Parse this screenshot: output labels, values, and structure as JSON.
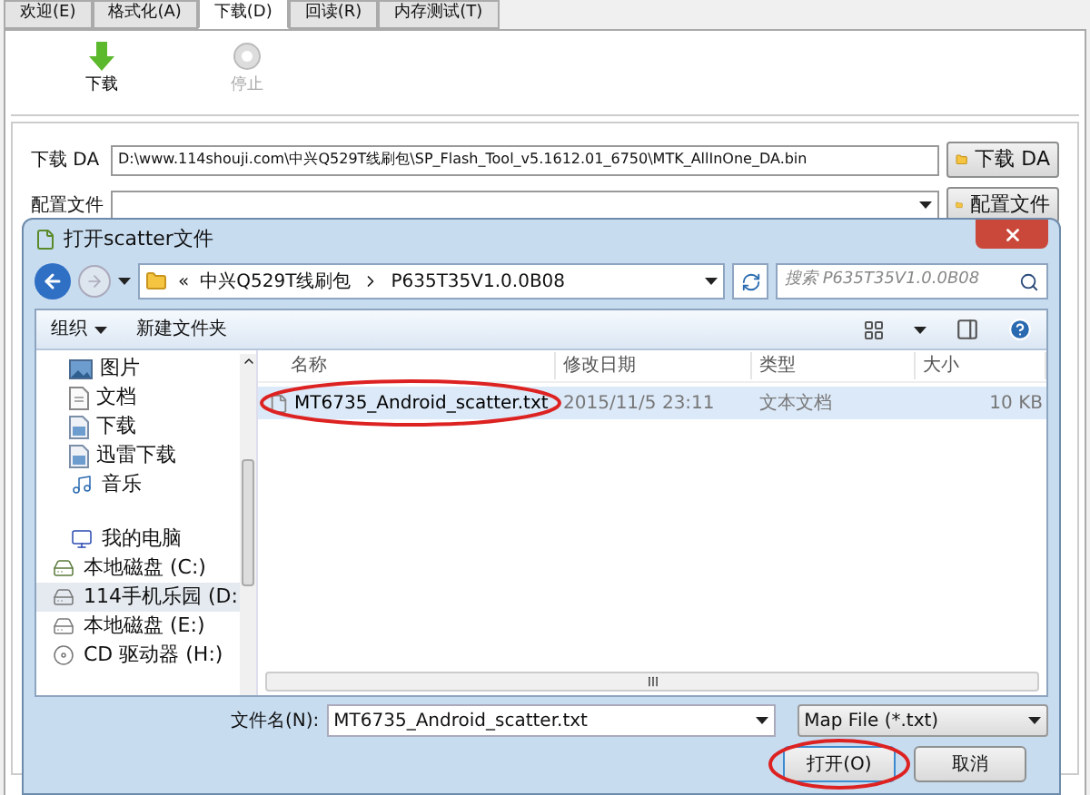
{
  "tabs": [
    {
      "label": "欢迎(E)",
      "selected": false
    },
    {
      "label": "格式化(A)",
      "selected": false
    },
    {
      "label": "下载(D)",
      "selected": true
    },
    {
      "label": "回读(R)",
      "selected": false
    },
    {
      "label": "内存测试(T)",
      "selected": false
    }
  ],
  "toolbar": [
    {
      "kind": "download",
      "label": "下载",
      "disabled": false
    },
    {
      "kind": "stop",
      "label": "停止",
      "disabled": true
    }
  ],
  "da_row": {
    "label": "下载 DA",
    "value": "D:\\www.114shouji.com\\中兴Q529T线刷包\\SP_Flash_Tool_v5.1612.01_6750\\MTK_AllInOne_DA.bin",
    "button": "下载 DA"
  },
  "config_row": {
    "label": "配置文件",
    "button": "配置文件"
  },
  "dialog": {
    "title": "打开scatter文件",
    "overflow": "«",
    "breadcrumb": [
      "中兴Q529T线刷包",
      "P635T35V1.0.0B08"
    ],
    "search": {
      "placeholder": "搜索 P635T35V1.0.0B08"
    },
    "commands": [
      {
        "label": "组织",
        "has_menu": true
      },
      {
        "label": "新建文件夹",
        "has_menu": false
      }
    ],
    "sidebar": [
      {
        "kind": "pictures",
        "label": "图片",
        "selected": false
      },
      {
        "kind": "documents",
        "label": "文档",
        "selected": false
      },
      {
        "kind": "downloads",
        "label": "下载",
        "selected": false
      },
      {
        "kind": "downloads",
        "label": "迅雷下载",
        "selected": false
      },
      {
        "kind": "music",
        "label": "音乐",
        "selected": false
      },
      {
        "kind": "computer",
        "label": "我的电脑",
        "selected": false,
        "children": [
          {
            "kind": "system-drive",
            "label": "本地磁盘 (C:)",
            "selected": false
          },
          {
            "kind": "drive",
            "label": "114手机乐园 (D:",
            "selected": true
          },
          {
            "kind": "drive",
            "label": "本地磁盘 (E:)",
            "selected": false
          },
          {
            "kind": "cd",
            "label": "CD 驱动器 (H:)",
            "selected": false
          }
        ]
      }
    ],
    "columns": [
      "名称",
      "修改日期",
      "类型",
      "大小"
    ],
    "rows": [
      {
        "name": "MT6735_Android_scatter.txt",
        "date": "2015/11/5 23:11",
        "type": "文本文档",
        "size": "10 KB",
        "selected": true,
        "circled": true
      }
    ],
    "filename_label": "文件名(N):",
    "filename": "MT6735_Android_scatter.txt",
    "filter": "Map File (*.txt)",
    "buttons": [
      {
        "label": "打开(O)",
        "default": true,
        "circled": true
      },
      {
        "label": "取消",
        "default": false,
        "circled": false
      }
    ]
  }
}
